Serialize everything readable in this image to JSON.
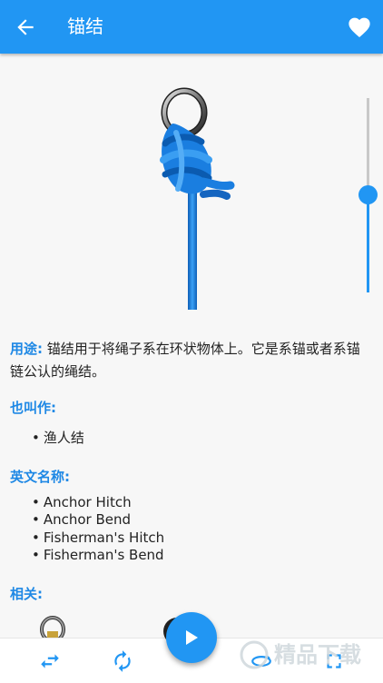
{
  "app_bar": {
    "title": "锚结",
    "back_icon": "arrow-back-icon",
    "favorite_icon": "heart-icon"
  },
  "speed_slider": {
    "value_fraction": 0.5
  },
  "usage": {
    "label": "用途:",
    "text": "锚结用于将绳子系在环状物体上。它是系锚或者系锚链公认的绳结。"
  },
  "also_known_as": {
    "title": "也叫作:",
    "items": [
      "渔人结"
    ]
  },
  "english_names": {
    "title": "英文名称:",
    "items": [
      "Anchor Hitch",
      "Anchor Bend",
      "Fisherman's Hitch",
      "Fisherman's Bend"
    ]
  },
  "related": {
    "title": "相关:"
  },
  "bottom_bar": {
    "left_icon": "swap-horizontal-icon",
    "rotate_icon": "rotate-icon",
    "play_icon": "play-icon",
    "orbit_icon": "orbit-rotate-icon",
    "fullscreen_icon": "fullscreen-icon"
  },
  "watermark": {
    "text": "精品下载"
  },
  "colors": {
    "primary": "#2196f3",
    "label": "#1e88e5",
    "rope": "#1e88e5"
  }
}
